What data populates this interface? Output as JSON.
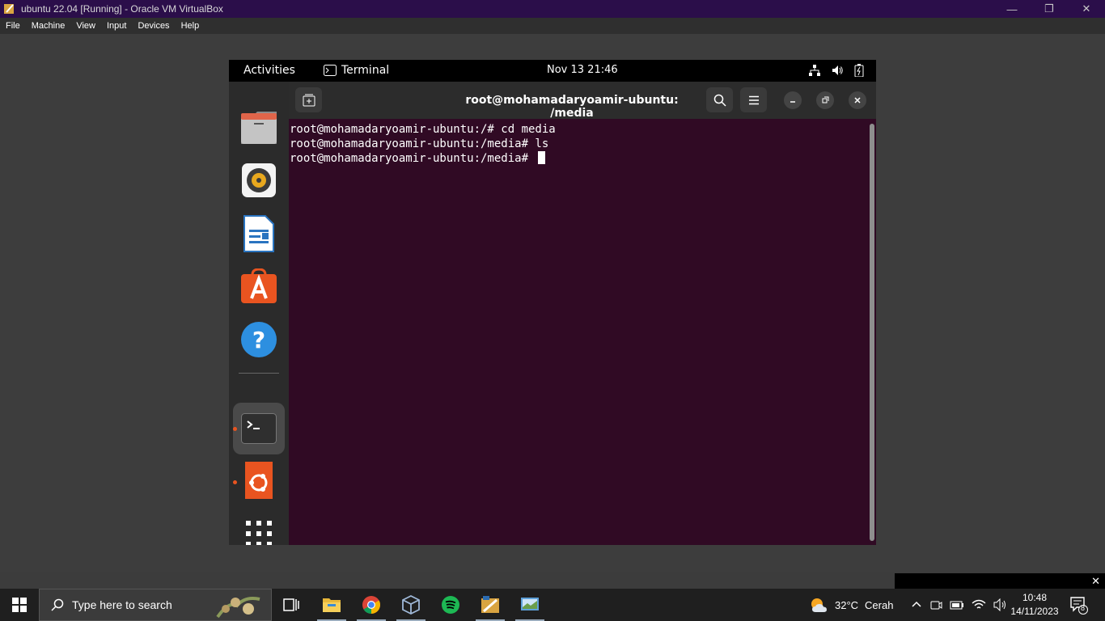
{
  "vbox": {
    "title": "ubuntu 22.04 [Running] - Oracle VM VirtualBox",
    "menu": [
      "File",
      "Machine",
      "View",
      "Input",
      "Devices",
      "Help"
    ]
  },
  "gnome": {
    "activities": "Activities",
    "app_name": "Terminal",
    "datetime": "Nov 13  21:46"
  },
  "dock": {
    "items": [
      "files-icon",
      "rhythmbox-icon",
      "libreoffice-writer-icon",
      "app-center-icon",
      "help-icon",
      "terminal-icon",
      "ubuntu-software-icon",
      "show-apps-icon"
    ]
  },
  "terminal": {
    "title": "root@mohamadaryoamir-ubuntu: /media",
    "lines": [
      "root@mohamadaryoamir-ubuntu:/# cd media",
      "root@mohamadaryoamir-ubuntu:/media# ls",
      "root@mohamadaryoamir-ubuntu:/media# "
    ]
  },
  "taskbar": {
    "search_placeholder": "Type here to search",
    "weather_temp": "32°C",
    "weather_desc": "Cerah",
    "time": "10:48",
    "date": "14/11/2023",
    "notification_count": "8"
  },
  "colors": {
    "terminal_bg": "#300a24",
    "vbox_titlebar": "#2b0e4a",
    "ubuntu_orange": "#e95420"
  }
}
